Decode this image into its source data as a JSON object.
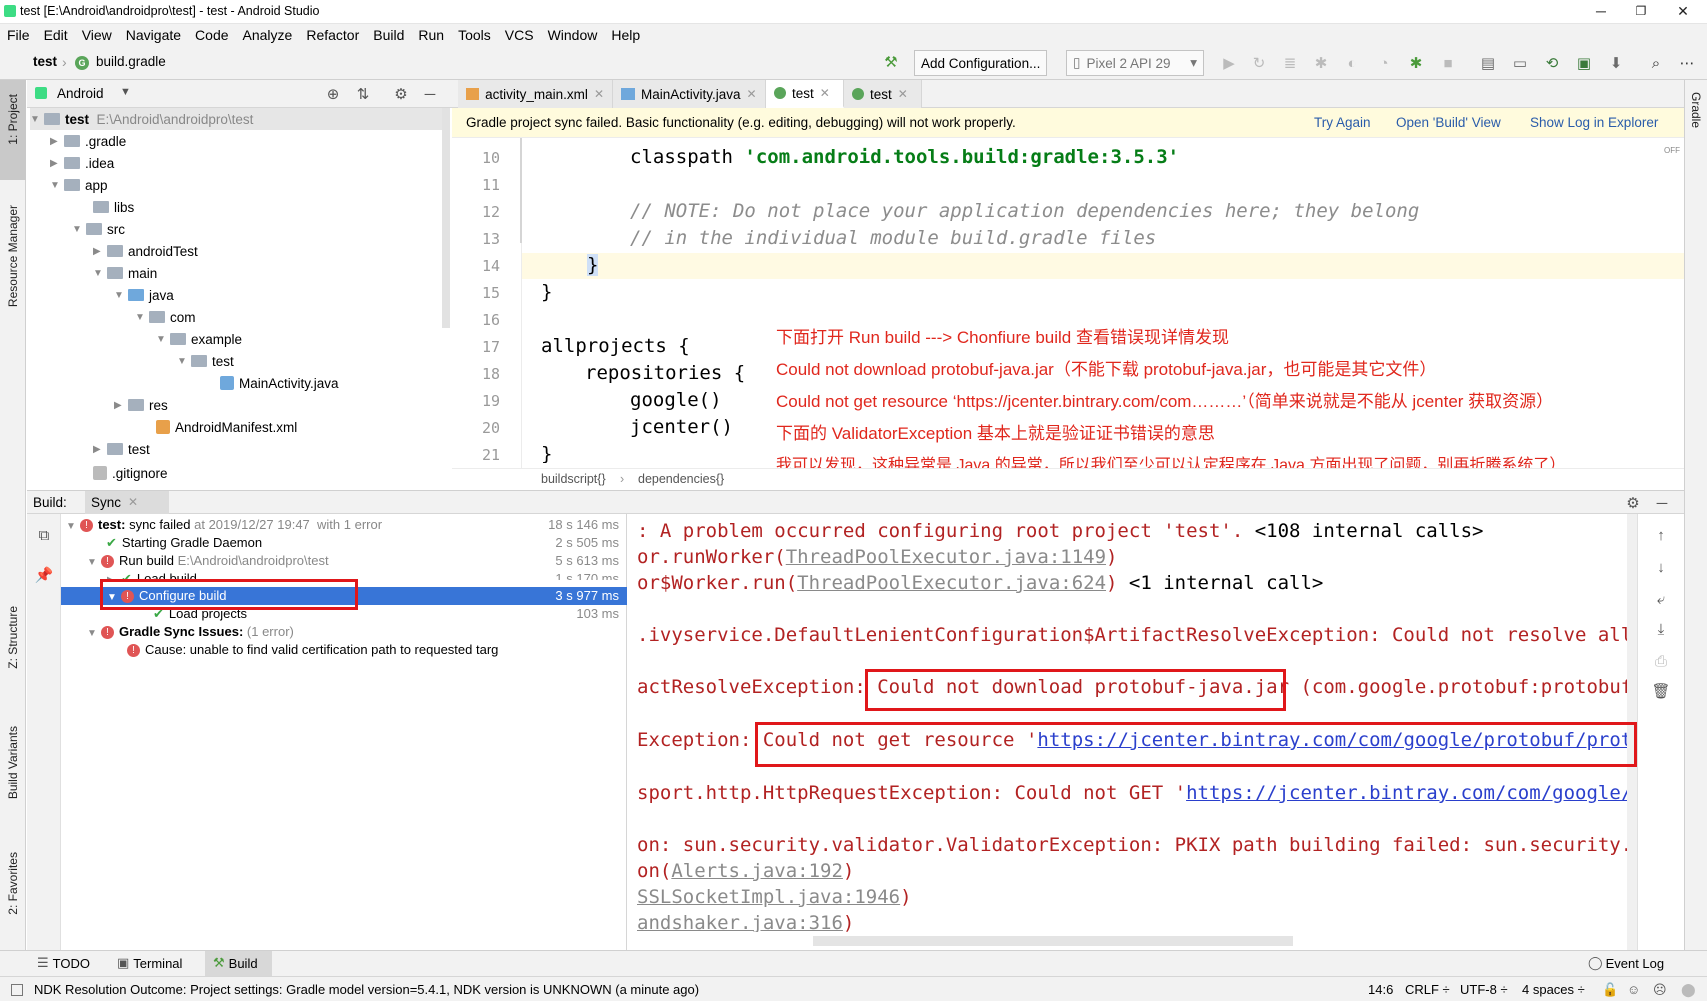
{
  "window": {
    "title": "test [E:\\Android\\androidpro\\test] - test - Android Studio"
  },
  "menu": [
    "File",
    "Edit",
    "View",
    "Navigate",
    "Code",
    "Analyze",
    "Refactor",
    "Build",
    "Run",
    "Tools",
    "VCS",
    "Window",
    "Help"
  ],
  "nav": {
    "project": "test",
    "file": "build.gradle",
    "add_config": "Add Configuration...",
    "device": "Pixel 2 API 29"
  },
  "left_tabs": [
    "1: Project",
    "Resource Manager",
    "Z: Structure",
    "Build Variants",
    "2: Favorites"
  ],
  "right_tabs": [
    "Gradle"
  ],
  "project_panel": {
    "view": "Android",
    "root_name": "test",
    "root_path": "E:\\Android\\androidpro\\test",
    "items": [
      ".gradle",
      ".idea",
      "app",
      "libs",
      "src",
      "androidTest",
      "main",
      "java",
      "com",
      "example",
      "test",
      "MainActivity.java",
      "res",
      "AndroidManifest.xml",
      "test",
      ".gitignore"
    ]
  },
  "editor_tabs": [
    {
      "label": "activity_main.xml"
    },
    {
      "label": "MainActivity.java"
    },
    {
      "label": "test"
    },
    {
      "label": "test"
    }
  ],
  "banner": {
    "message": "Gradle project sync failed. Basic functionality (e.g. editing, debugging) will not work properly.",
    "actions": [
      "Try Again",
      "Open 'Build' View",
      "Show Log in Explorer"
    ]
  },
  "editor": {
    "line_numbers": [
      "10",
      "11",
      "12",
      "13",
      "14",
      "15",
      "16",
      "17",
      "18",
      "19",
      "20",
      "21"
    ],
    "lines": {
      "l10a": "classpath ",
      "l10b": "'com.android.tools.build:gradle:3.5.3'",
      "l12": "// NOTE: Do not place your application dependencies here; they belong",
      "l13": "// in the individual module build.gradle files",
      "l14": "}",
      "l15": "}",
      "l17": "allprojects {",
      "l18": "repositories {",
      "l19": "google()",
      "l20": "jcenter()",
      "l21": "}"
    },
    "off_label": "OFF",
    "notes": [
      "下面打开 Run build ---> Chonfiure build 查看错误现详情发现",
      "Could not download protobuf-java.jar（不能下载 protobuf-java.jar，也可能是其它文件）",
      "Could not get resource ‘https://jcenter.bintrary.com/com………’（简单来说就是不能从 jcenter 获取资源）",
      "下面的 ValidatorException 基本上就是验证证书错误的意思",
      "我可以发现，这种异常是 Java 的异常，所以我们至少可以认定程序在 Java 方面出现了问题，别再折腾系统了）"
    ],
    "breadcrumb": [
      "buildscript{}",
      "dependencies{}"
    ]
  },
  "build_panel": {
    "title": "Build:",
    "tab": "Sync",
    "rows": [
      {
        "label": "test:",
        "suffix": " sync failed",
        "meta": "at 2019/12/27 19:47",
        "extra": "with 1 error",
        "time": "18 s 146 ms"
      },
      {
        "label": "Starting Gradle Daemon",
        "time": "2 s 505 ms"
      },
      {
        "label": "Run build",
        "meta": "E:\\Android\\androidpro\\test",
        "time": "5 s 613 ms"
      },
      {
        "label": "Load build",
        "time": "1 s 170 ms"
      },
      {
        "label": "Configure build",
        "time": "3 s 977 ms"
      },
      {
        "label": "Load projects",
        "time": "103 ms"
      },
      {
        "label": "Gradle Sync Issues:",
        "meta": "(1 error)"
      },
      {
        "label": "Cause: unable to find valid certification path to requested targ"
      }
    ],
    "console": {
      "c1a": ": A problem occurred configuring root project 'test'.",
      "c1b": " <108 internal calls>",
      "c2a": "or.runWorker(",
      "c2b": "ThreadPoolExecutor.java:1149",
      "c2c": ")",
      "c3a": "or$Worker.run(",
      "c3b": "ThreadPoolExecutor.java:624",
      "c3c": ")",
      "c3d": " <1 internal call>",
      "c4": ".ivyservice.DefaultLenientConfiguration$ArtifactResolveException: Could not resolve all ar",
      "c5a": "actResolveException: ",
      "c5b": "Could not download protobuf-java.jar",
      "c5c": " (com.google.protobuf:protobuf-ja",
      "c6a": "Exception: ",
      "c6b": "Could not get resource '",
      "c6c": "https://jcenter.bintray.com/com/google/protobuf/protob",
      "c7a": "sport.http.HttpRequestException: Could not GET '",
      "c7b": "https://jcenter.bintray.com/com/google/pro",
      "c8": "on: sun.security.validator.ValidatorException: PKIX path building failed: sun.security.pro",
      "c9a": "on(",
      "c9b": "Alerts.java:192",
      "c9c": ")",
      "c10a": "SSLSocketImpl.java:1946",
      "c10b": ")",
      "c11a": "andshaker.java:316",
      "c11b": ")"
    }
  },
  "bottom_tabs": [
    "TODO",
    "Terminal",
    "Build",
    "Event Log"
  ],
  "status": {
    "message": "NDK Resolution Outcome: Project settings: Gradle model version=5.4.1, NDK version is UNKNOWN (a minute ago)",
    "position": "14:6",
    "line_sep": "CRLF ÷",
    "encoding": "UTF-8 ÷",
    "indent": "4 spaces ÷"
  },
  "colors": {
    "accent": "#3875d7",
    "error": "#e05555",
    "annotation": "#e0271d",
    "highlight_box": "#e0171a"
  }
}
